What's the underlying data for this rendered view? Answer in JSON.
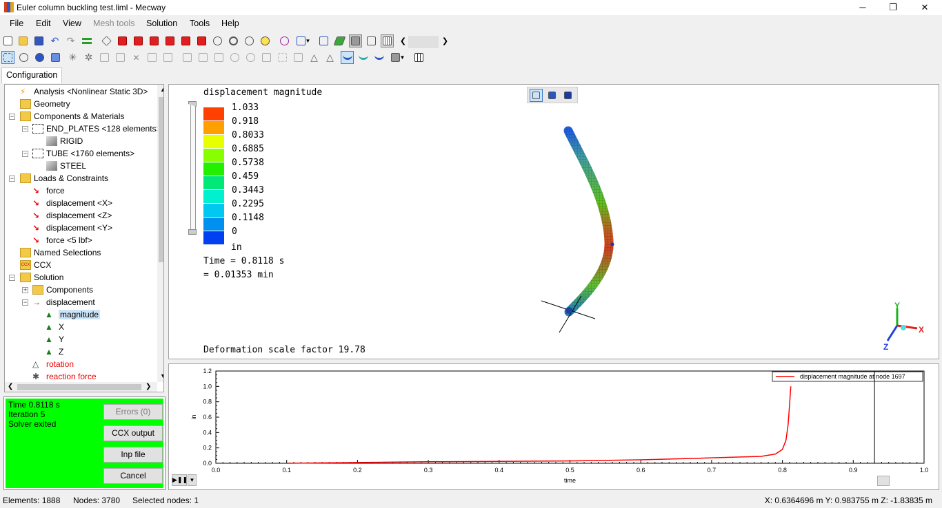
{
  "window": {
    "title": "Euler column buckling test.liml - Mecway",
    "minimize": "─",
    "maximize": "❐",
    "close": "✕"
  },
  "menu": [
    "File",
    "Edit",
    "View",
    "Mesh tools",
    "Solution",
    "Tools",
    "Help"
  ],
  "tabs": {
    "configuration": "Configuration"
  },
  "tree": {
    "analysis": "Analysis <Nonlinear Static 3D>",
    "geometry": "Geometry",
    "components_materials": "Components & Materials",
    "end_plates": "END_PLATES <128 elements>",
    "rigid": "RIGID",
    "tube": "TUBE <1760 elements>",
    "steel": "STEEL",
    "loads": "Loads & Constraints",
    "force": "force",
    "disp_x": "displacement <X>",
    "disp_z": "displacement <Z>",
    "disp_y": "displacement <Y>",
    "force5": "force <5 lbf>",
    "named": "Named Selections",
    "ccx": "CCX",
    "ccx_badge": "CCX",
    "solution": "Solution",
    "components": "Components",
    "displacement": "displacement",
    "magnitude": "magnitude",
    "x": "X",
    "y": "Y",
    "z": "Z",
    "rotation": "rotation",
    "reaction": "reaction force"
  },
  "solver": {
    "time": "Time 0.8118 s",
    "iteration": "Iteration 5",
    "status": "Solver exited",
    "errors_btn": "Errors (0)",
    "ccx_output_btn": "CCX output",
    "inp_file_btn": "Inp file",
    "cancel_btn": "Cancel"
  },
  "viewport": {
    "result_title": "displacement magnitude",
    "legend_values": [
      "1.033",
      "0.918",
      "0.8033",
      "0.6885",
      "0.5738",
      "0.459",
      "0.3443",
      "0.2295",
      "0.1148",
      "0"
    ],
    "legend_colors": [
      "#ff4000",
      "#ff9f00",
      "#e8ff00",
      "#88ff00",
      "#22f000",
      "#00e878",
      "#00f0d0",
      "#00c8f0",
      "#0090f0",
      "#0040f0"
    ],
    "unit": "in",
    "time_s": "Time = 0.8118 s",
    "time_min": "= 0.01353 min",
    "scale_factor": "Deformation scale factor 19.78",
    "axes": {
      "x": "X",
      "y": "Y",
      "z": "Z"
    }
  },
  "chart_data": {
    "type": "line",
    "title": "",
    "xlabel": "time",
    "ylabel": "in",
    "xlim": [
      0,
      1
    ],
    "ylim": [
      0,
      1.2
    ],
    "x_ticks": [
      "0.0",
      "0.1",
      "0.2",
      "0.3",
      "0.4",
      "0.5",
      "0.6",
      "0.7",
      "0.8",
      "0.9",
      "1.0"
    ],
    "y_ticks": [
      "0.0",
      "0.2",
      "0.4",
      "0.6",
      "0.8",
      "1.0",
      "1.2"
    ],
    "cursor_x": 0.93,
    "legend_position": "top-right",
    "series": [
      {
        "name": "displacement magnitude at node 1697",
        "color": "#ff0000",
        "x": [
          0.1,
          0.2,
          0.3,
          0.4,
          0.5,
          0.6,
          0.7,
          0.77,
          0.79,
          0.8,
          0.805,
          0.808,
          0.81,
          0.8118
        ],
        "y": [
          0.0,
          0.01,
          0.02,
          0.025,
          0.03,
          0.045,
          0.07,
          0.09,
          0.12,
          0.18,
          0.3,
          0.5,
          0.75,
          1.0
        ]
      }
    ]
  },
  "statusbar": {
    "elements": "Elements: 1888",
    "nodes": "Nodes: 3780",
    "selected": "Selected nodes: 1",
    "coords": "X: 0.6364696 m Y: 0.983755 m Z: -1.83835 m"
  }
}
